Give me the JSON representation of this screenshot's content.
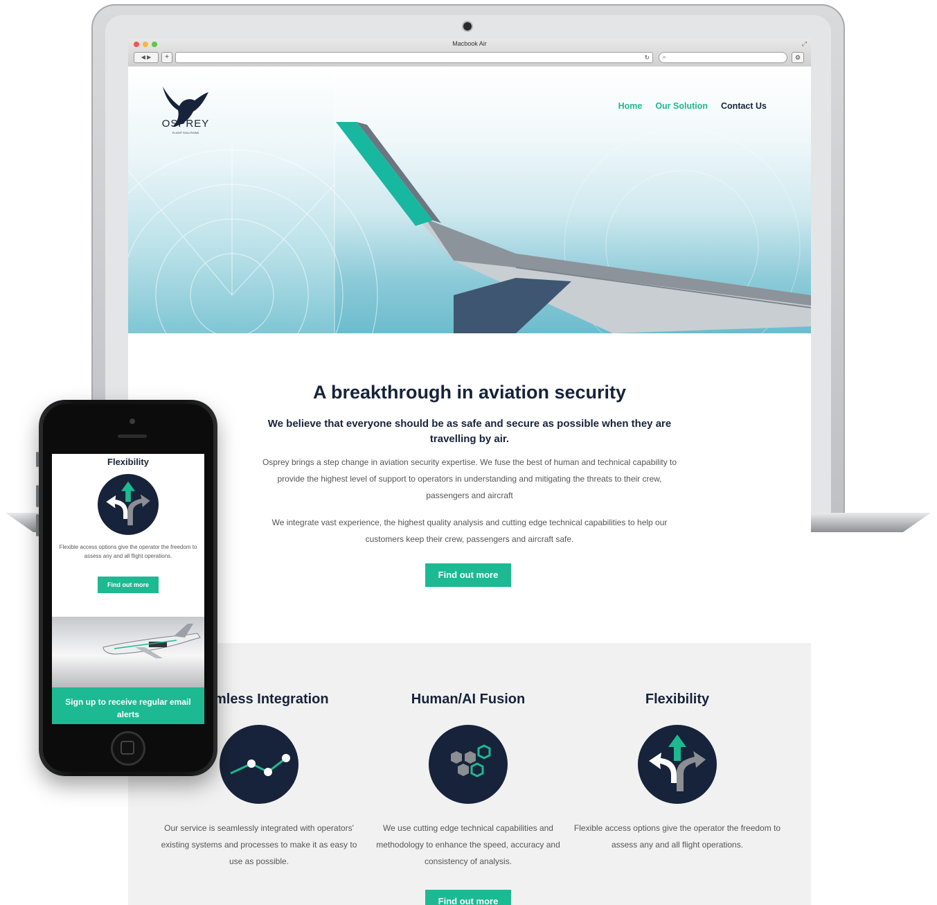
{
  "window": {
    "title": "Macbook Air"
  },
  "browser": {
    "back_forward": "◀ ▶",
    "new_tab": "+",
    "reload": "↻",
    "search_icon": "🔍",
    "gear": "⚙"
  },
  "site": {
    "logo_text": "OSPREY",
    "logo_sub": "FLIGHT SOLUTIONS",
    "nav": [
      {
        "label": "Home"
      },
      {
        "label": "Our Solution"
      },
      {
        "label": "Contact Us"
      }
    ],
    "colors": {
      "accent": "#1db992",
      "navy": "#17233a"
    }
  },
  "intro": {
    "heading": "A breakthrough in aviation security",
    "subheading": "We believe that everyone should be as safe and secure as possible when they are travelling by air.",
    "paragraph1": "Osprey brings a step change in aviation security expertise. We fuse the best of human and technical capability to provide the highest level of support to operators in understanding and mitigating the threats to their crew, passengers and aircraft",
    "paragraph2": "We integrate vast experience, the highest quality analysis and cutting edge technical capabilities to help our customers keep their crew, passengers and aircraft safe.",
    "button": "Find out more"
  },
  "features": {
    "items": [
      {
        "title": "Seamless Integration",
        "icon": "line-graph-icon",
        "text": "Our service is seamlessly integrated with operators' existing systems and processes to make it as easy to use as possible."
      },
      {
        "title": "Human/AI Fusion",
        "icon": "hexagons-icon",
        "text": "We use cutting edge technical capabilities and methodology to enhance the speed, accuracy and consistency of analysis."
      },
      {
        "title": "Flexibility",
        "icon": "split-arrows-icon",
        "text": "Flexible access options give the operator the freedom to assess any and all flight operations."
      }
    ],
    "button": "Find out more"
  },
  "phone": {
    "title": "Flexibility",
    "text": "Flexible access options give the operator the freedom to assess any and all flight operations.",
    "button": "Find out more",
    "signup": "Sign up to receive regular email alerts"
  }
}
